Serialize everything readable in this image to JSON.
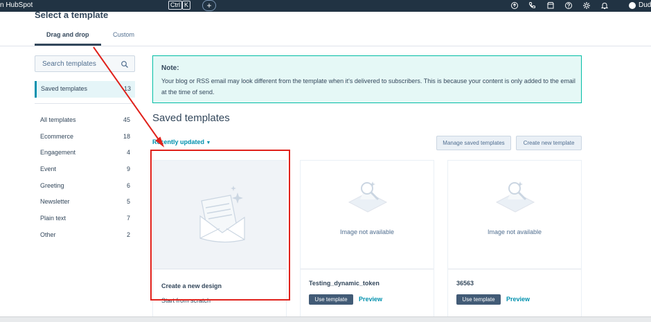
{
  "topbar": {
    "brand": "n HubSpot",
    "shortcut_key1": "Ctrl",
    "shortcut_key2": "K",
    "plus": "+",
    "user_name": "Dud",
    "icons": [
      "upgrade-icon",
      "phone-icon",
      "marketplace-icon",
      "help-icon",
      "settings-icon",
      "notifications-icon"
    ]
  },
  "page": {
    "title": "Select a template",
    "tabs": [
      {
        "label": "Drag and drop",
        "active": true
      },
      {
        "label": "Custom",
        "active": false
      }
    ]
  },
  "sidebar": {
    "search_placeholder": "Search templates",
    "saved": {
      "label": "Saved templates",
      "count": "13"
    },
    "categories": [
      {
        "label": "All templates",
        "count": "45"
      },
      {
        "label": "Ecommerce",
        "count": "18"
      },
      {
        "label": "Engagement",
        "count": "4"
      },
      {
        "label": "Event",
        "count": "9"
      },
      {
        "label": "Greeting",
        "count": "6"
      },
      {
        "label": "Newsletter",
        "count": "5"
      },
      {
        "label": "Plain text",
        "count": "7"
      },
      {
        "label": "Other",
        "count": "2"
      }
    ]
  },
  "note": {
    "title": "Note:",
    "body": "Your blog or RSS email may look different from the template when it's delivered to subscribers. This is because your content is only added to the email at the time of send."
  },
  "main": {
    "section_title": "Saved templates",
    "sort_label": "Recently updated",
    "manage_button": "Manage saved templates",
    "create_button": "Create new template",
    "create_card": {
      "title": "Create a new design",
      "subtitle": "Start from scratch"
    },
    "templates": [
      {
        "name": "Testing_dynamic_token",
        "image_text": "Image not available",
        "use_label": "Use template",
        "preview_label": "Preview"
      },
      {
        "name": "36563",
        "image_text": "Image not available",
        "use_label": "Use template",
        "preview_label": "Preview"
      }
    ]
  },
  "colors": {
    "topbar": "#213343",
    "accent": "#0091ae",
    "note_bg": "#e5f8f6",
    "note_border": "#00bda5",
    "primary_button": "#425b76",
    "annotation": "#e0211b"
  }
}
